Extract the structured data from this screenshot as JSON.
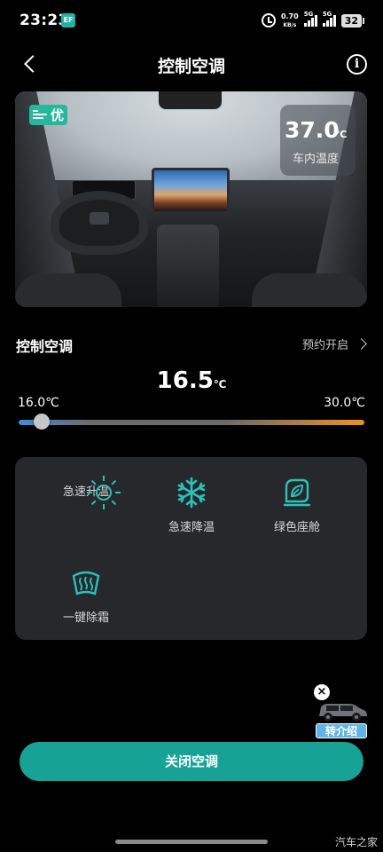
{
  "status_bar": {
    "time": "23:23",
    "net_speed": "0.70",
    "net_unit": "KB/s",
    "signal1_label": "5G",
    "signal2_label": "5G",
    "battery": "32"
  },
  "header": {
    "title": "控制空调"
  },
  "car_image": {
    "air_quality_label": "优",
    "cabin_temp_value": "37.0",
    "cabin_temp_unit": "℃",
    "cabin_temp_label": "车内温度"
  },
  "control": {
    "section_title": "控制空调",
    "schedule_label": "预约开启",
    "set_temp_value": "16.5",
    "set_temp_unit": "℃",
    "range_min": "16.0℃",
    "range_max": "30.0℃",
    "slider_fraction": 0.036
  },
  "modes": [
    {
      "label": "急速升温",
      "icon": "sun-icon"
    },
    {
      "label": "急速降温",
      "icon": "snowflake-icon"
    },
    {
      "label": "绿色座舱",
      "icon": "green-cabin-icon"
    },
    {
      "label": "一键除霜",
      "icon": "defrost-icon"
    }
  ],
  "promo": {
    "label": "转介绍"
  },
  "bottom": {
    "close_ac_label": "关闭空调"
  },
  "watermark": "汽车之家",
  "colors": {
    "accent": "#16a396",
    "icon_teal": "#2ac1b8",
    "badge_green": "#26b89b",
    "panel_bg": "#26282c"
  }
}
